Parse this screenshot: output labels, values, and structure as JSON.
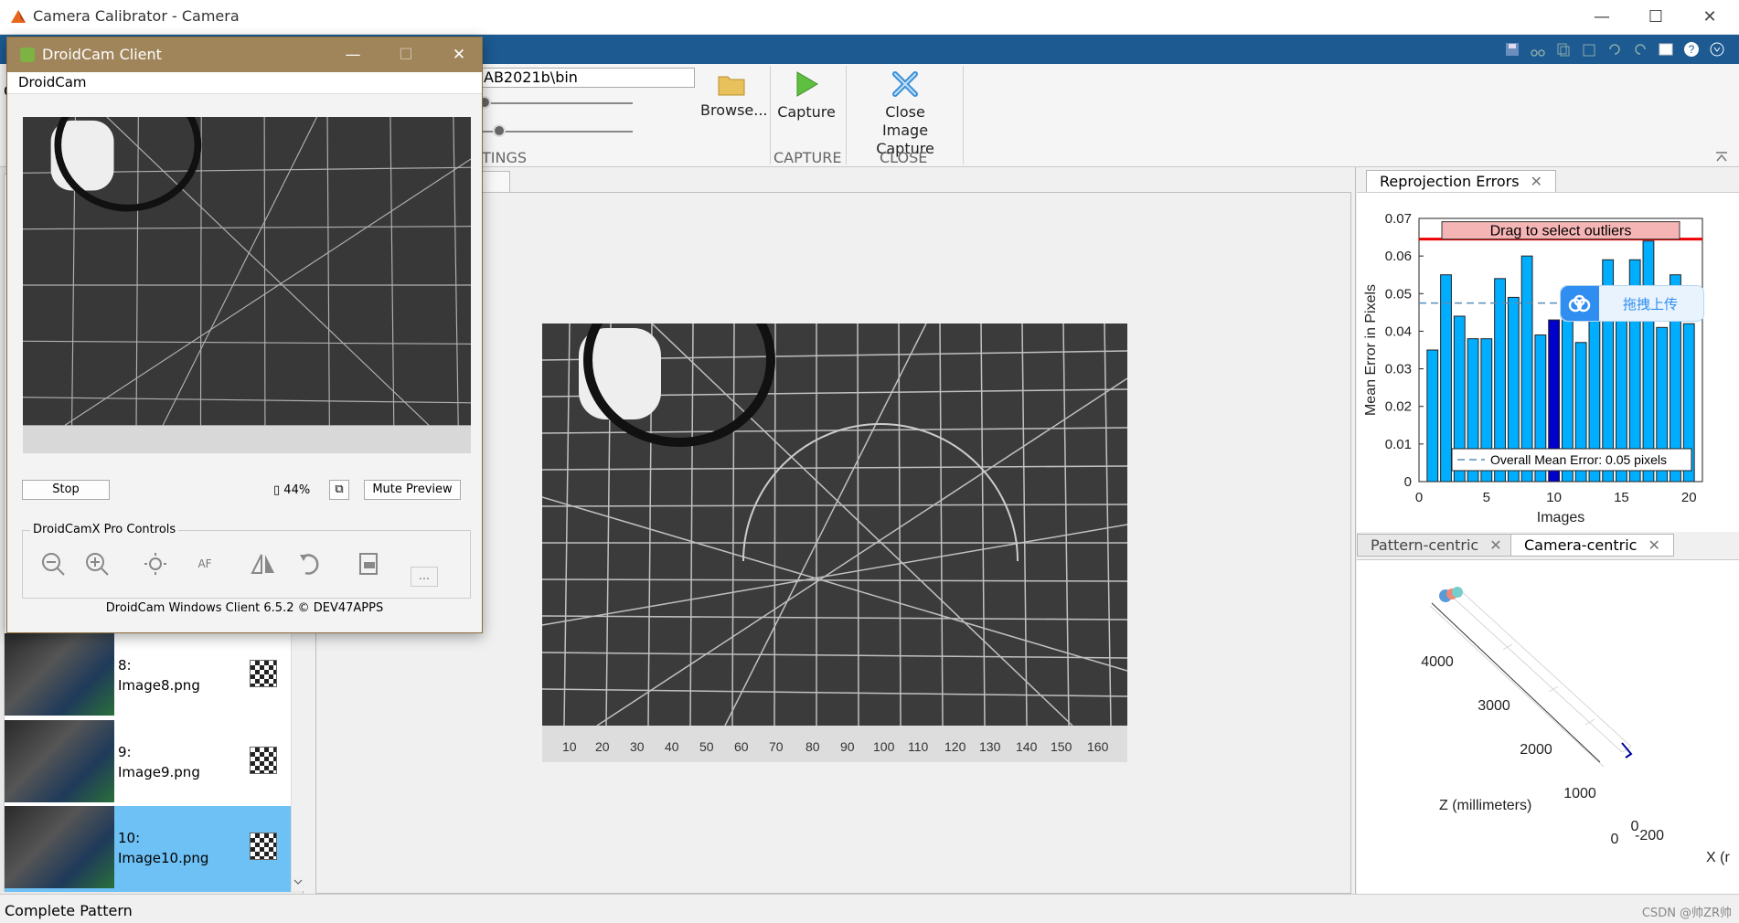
{
  "window": {
    "title": "Camera Calibrator - Camera",
    "minimize": "—",
    "maximize": "☐",
    "close": "✕"
  },
  "ribbon": {
    "path_value": "AB2021b\\bin",
    "browse_label": "Browse...",
    "capture_label": "Capture",
    "close_label_1": "Close",
    "close_label_2": "Image Capture",
    "section_settings": "TINGS",
    "section_capture": "CAPTURE",
    "section_close": "CLOSE",
    "left_stub": "C"
  },
  "image_list": [
    {
      "index": "8:",
      "name": "Image8.png",
      "selected": false
    },
    {
      "index": "9:",
      "name": "Image9.png",
      "selected": false
    },
    {
      "index": "10:",
      "name": "Image10.png",
      "selected": true
    }
  ],
  "droidcam": {
    "title": "DroidCam Client",
    "menu": "DroidCam",
    "stop_label": "Stop",
    "battery": "44%",
    "mute_label": "Mute Preview",
    "pro_controls_label": "DroidCamX Pro Controls",
    "af_label": "AF",
    "more_label": "...",
    "footer": "DroidCam Windows Client 6.5.2 © DEV47APPS"
  },
  "tabs": {
    "reprojection": "Reprojection Errors",
    "pattern_centric": "Pattern-centric",
    "camera_centric": "Camera-centric"
  },
  "upload_badge": "拖拽上传",
  "chart_data": [
    {
      "type": "bar",
      "title": "",
      "xlabel": "Images",
      "ylabel": "Mean Error in Pixels",
      "ylim": [
        0,
        0.07
      ],
      "xlim": [
        0,
        21
      ],
      "yticks": [
        "0",
        "0.01",
        "0.02",
        "0.03",
        "0.04",
        "0.05",
        "0.06",
        "0.07"
      ],
      "xticks": [
        "0",
        "5",
        "10",
        "15",
        "20"
      ],
      "categories": [
        1,
        2,
        3,
        4,
        5,
        6,
        7,
        8,
        9,
        10,
        11,
        12,
        13,
        14,
        15,
        16,
        17,
        18,
        19,
        20
      ],
      "values": [
        0.035,
        0.055,
        0.044,
        0.038,
        0.038,
        0.054,
        0.049,
        0.06,
        0.039,
        0.043,
        0.044,
        0.037,
        0.046,
        0.059,
        0.045,
        0.059,
        0.064,
        0.041,
        0.055,
        0.042
      ],
      "selected_index": 10,
      "bar_color": "#00aeff",
      "selected_color": "#0000cc",
      "threshold": 0.0645,
      "threshold_label": "Drag to select outliers",
      "mean_error": 0.0475,
      "legend": "Overall Mean Error: 0.05 pixels"
    },
    {
      "type": "scatter",
      "title": "",
      "zlabel": "Z (millimeters)",
      "xlabel_partial": "X (r",
      "z_ticks": [
        "4000",
        "3000",
        "2000",
        "1000",
        "0"
      ],
      "x_ticks": [
        "-200",
        "0"
      ]
    }
  ],
  "status": "Complete Pattern",
  "watermark": "CSDN @帅ZR帅"
}
